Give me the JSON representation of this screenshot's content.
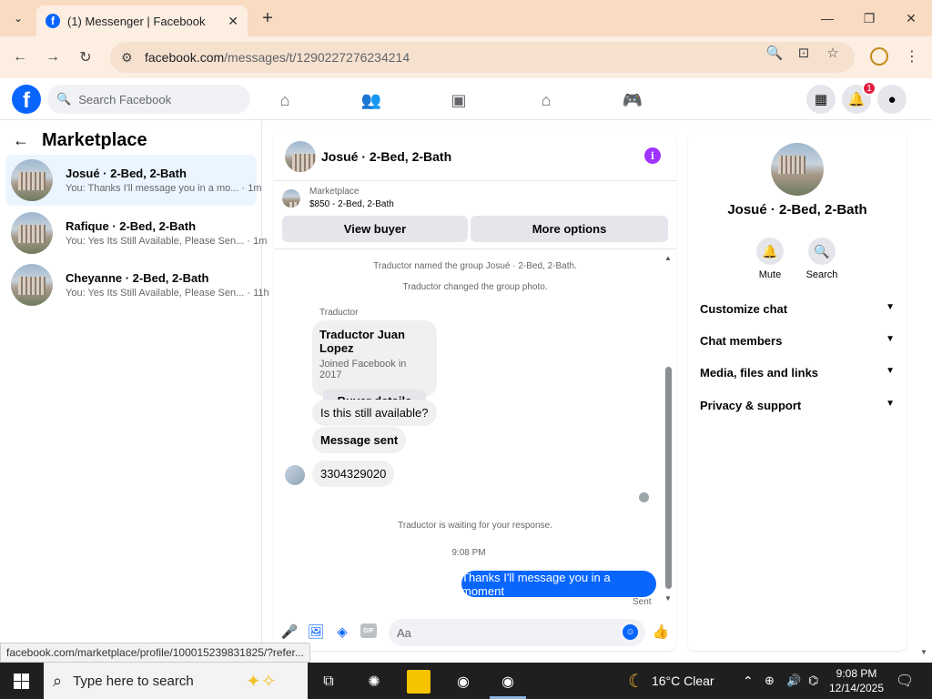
{
  "browser": {
    "tab_title": "(1) Messenger | Facebook",
    "url_host": "facebook.com",
    "url_path": "/messages/t/1290227276234214",
    "status_url": "facebook.com/marketplace/profile/100015239831825/?refer..."
  },
  "fb": {
    "search_placeholder": "Search Facebook",
    "notification_count": "1"
  },
  "sidebar": {
    "title": "Marketplace",
    "conversations": [
      {
        "name": "Josué · 2-Bed, 2-Bath",
        "preview": "You: Thanks I'll message you in a mo...",
        "time": "· 1m"
      },
      {
        "name": "Rafique · 2-Bed, 2-Bath",
        "preview": "You: Yes Its Still Available, Please Sen...",
        "time": "· 1m"
      },
      {
        "name": "Cheyanne · 2-Bed, 2-Bath",
        "preview": "You: Yes Its Still Available, Please Sen...",
        "time": "· 11h"
      }
    ]
  },
  "chat": {
    "title": "Josué · 2-Bed, 2-Bath",
    "listing_source": "Marketplace",
    "listing_detail": "$850 - 2-Bed, 2-Bath",
    "view_buyer": "View buyer",
    "more_options": "More options",
    "sys_1": "Traductor named the group Josué · 2-Bed, 2-Bath.",
    "sys_2": "Traductor changed the group photo.",
    "sender": "Traductor",
    "card_name": "Traductor Juan Lopez",
    "card_sub": "Joined Facebook in 2017",
    "card_button": "Buyer details",
    "msg_1": "Is this still available?",
    "msg_2": "Message sent",
    "msg_3": "3304329020",
    "sys_3": "Traductor is waiting for your response.",
    "time": "9:08 PM",
    "outgoing": "Thanks I'll message you in a moment",
    "sent": "Sent",
    "composer_placeholder": "Aa",
    "gif_label": "GIF"
  },
  "details": {
    "name": "Josué · 2-Bed, 2-Bath",
    "mute": "Mute",
    "search": "Search",
    "sections": [
      "Customize chat",
      "Chat members",
      "Media, files and links",
      "Privacy & support"
    ]
  },
  "taskbar": {
    "search_placeholder": "Type here to search",
    "weather": "16°C  Clear",
    "time": "9:08 PM",
    "date": "12/14/2025"
  }
}
